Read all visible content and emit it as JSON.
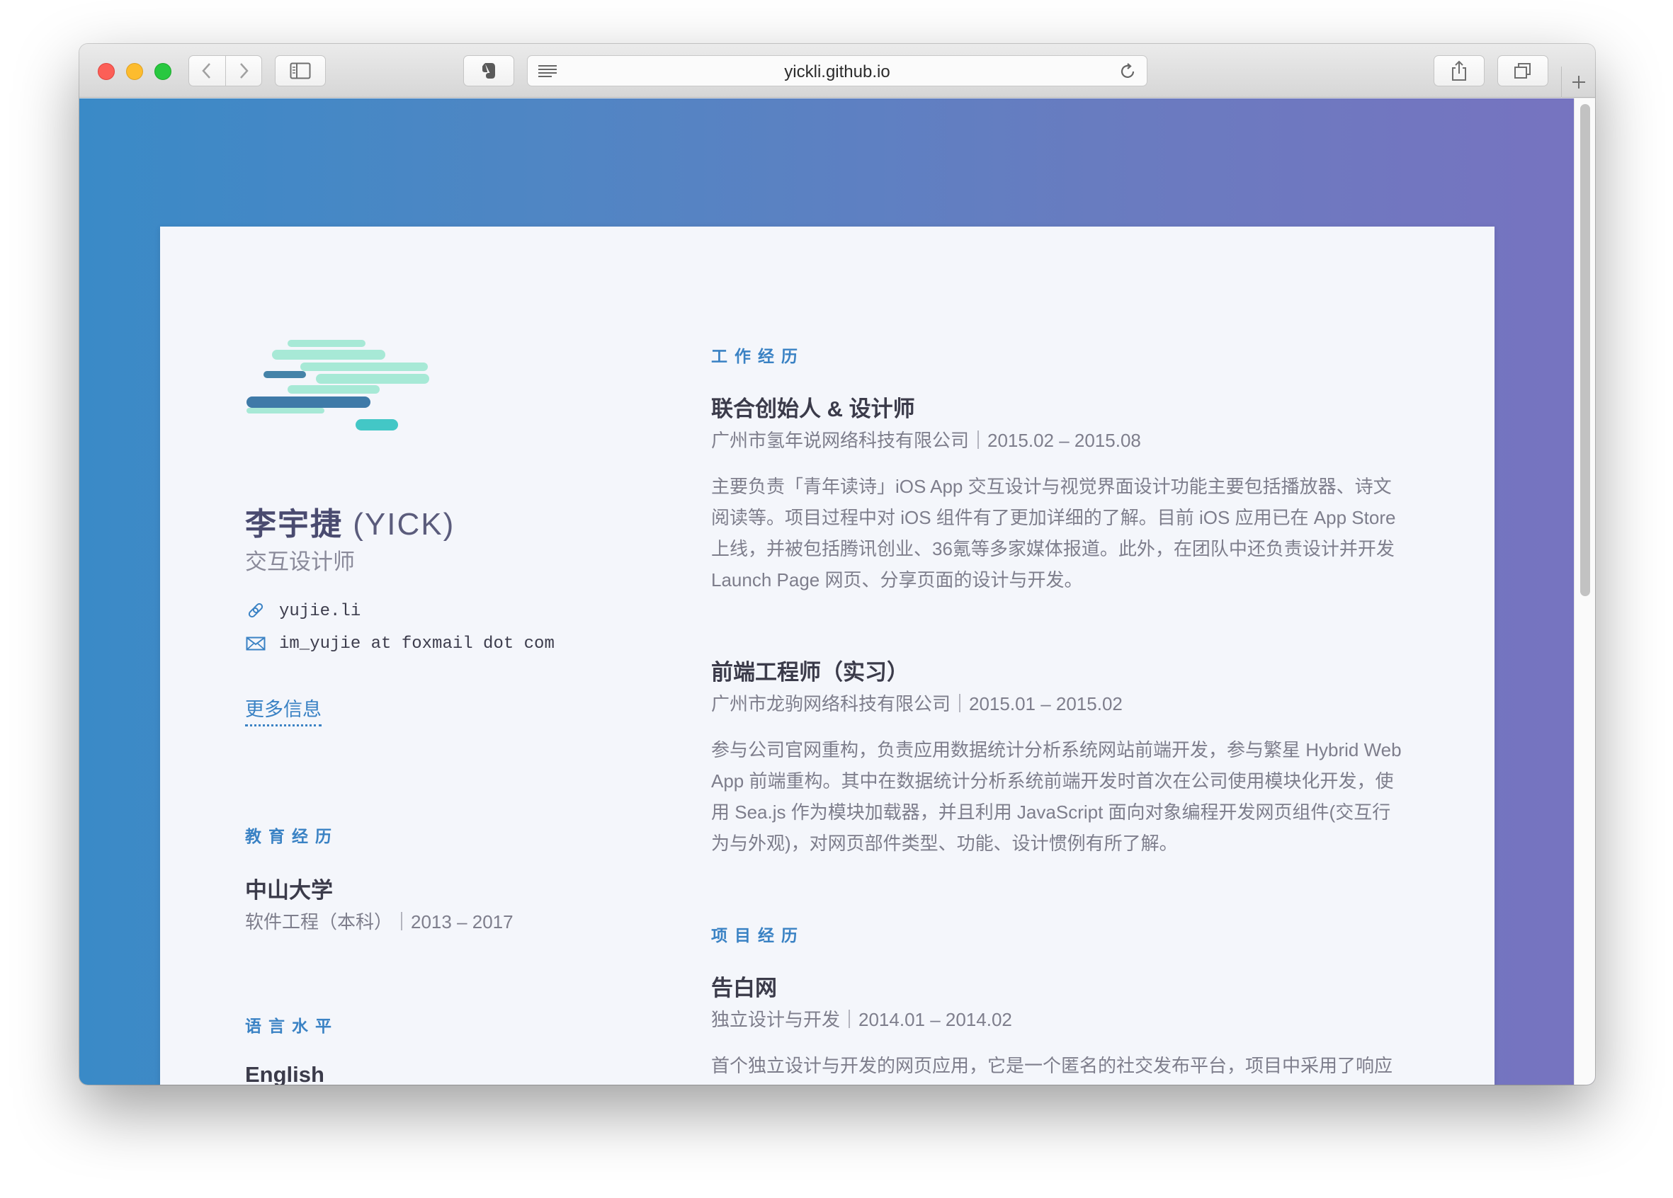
{
  "browser": {
    "url": "yickli.github.io"
  },
  "profile": {
    "name_cn": "李宇捷",
    "name_en": "(YICK)",
    "role": "交互设计师",
    "website": "yujie.li",
    "email": "im_yujie at foxmail dot com",
    "more_link": "更多信息"
  },
  "education": {
    "title": "教育经历",
    "school": "中山大学",
    "detail": "软件工程（本科）｜2013 – 2017"
  },
  "language": {
    "title": "语言水平",
    "item": "English"
  },
  "work": {
    "title": "工作经历",
    "jobs": [
      {
        "position": "联合创始人 & 设计师",
        "meta": "广州市氢年说网络科技有限公司｜2015.02 – 2015.08",
        "lines": [
          "主要负责「青年读诗」iOS App 交互设计与视觉界面设计功能主要包括播放器、诗文",
          "阅读等。项目过程中对 iOS 组件有了更加详细的了解。目前 iOS 应用已在 App Store",
          "上线，并被包括腾讯创业、36氪等多家媒体报道。此外，在团队中还负责设计并开发",
          "Launch Page 网页、分享页面的设计与开发。"
        ]
      },
      {
        "position": "前端工程师（实习）",
        "meta": "广州市龙驹网络科技有限公司｜2015.01 – 2015.02",
        "lines": [
          "参与公司官网重构，负责应用数据统计分析系统网站前端开发，参与繁星 Hybrid Web",
          "App 前端重构。其中在数据统计分析系统前端开发时首次在公司使用模块化开发，使",
          "用 Sea.js 作为模块加载器，并且利用 JavaScript 面向对象编程开发网页组件(交互行",
          "为与外观)，对网页部件类型、功能、设计惯例有所了解。"
        ]
      }
    ]
  },
  "projects": {
    "title": "项目经历",
    "items": [
      {
        "name": "告白网",
        "meta": "独立设计与开发｜2014.01 – 2014.02",
        "lines": [
          "首个独立设计与开发的网页应用，它是一个匿名的社交发布平台，项目中采用了响应"
        ]
      }
    ]
  },
  "colors": {
    "accent": "#3a82c4",
    "heading": "#3b3b4a",
    "muted": "#7e7e8c",
    "gradient_start": "#3a8ac7",
    "gradient_end": "#7773c0"
  }
}
